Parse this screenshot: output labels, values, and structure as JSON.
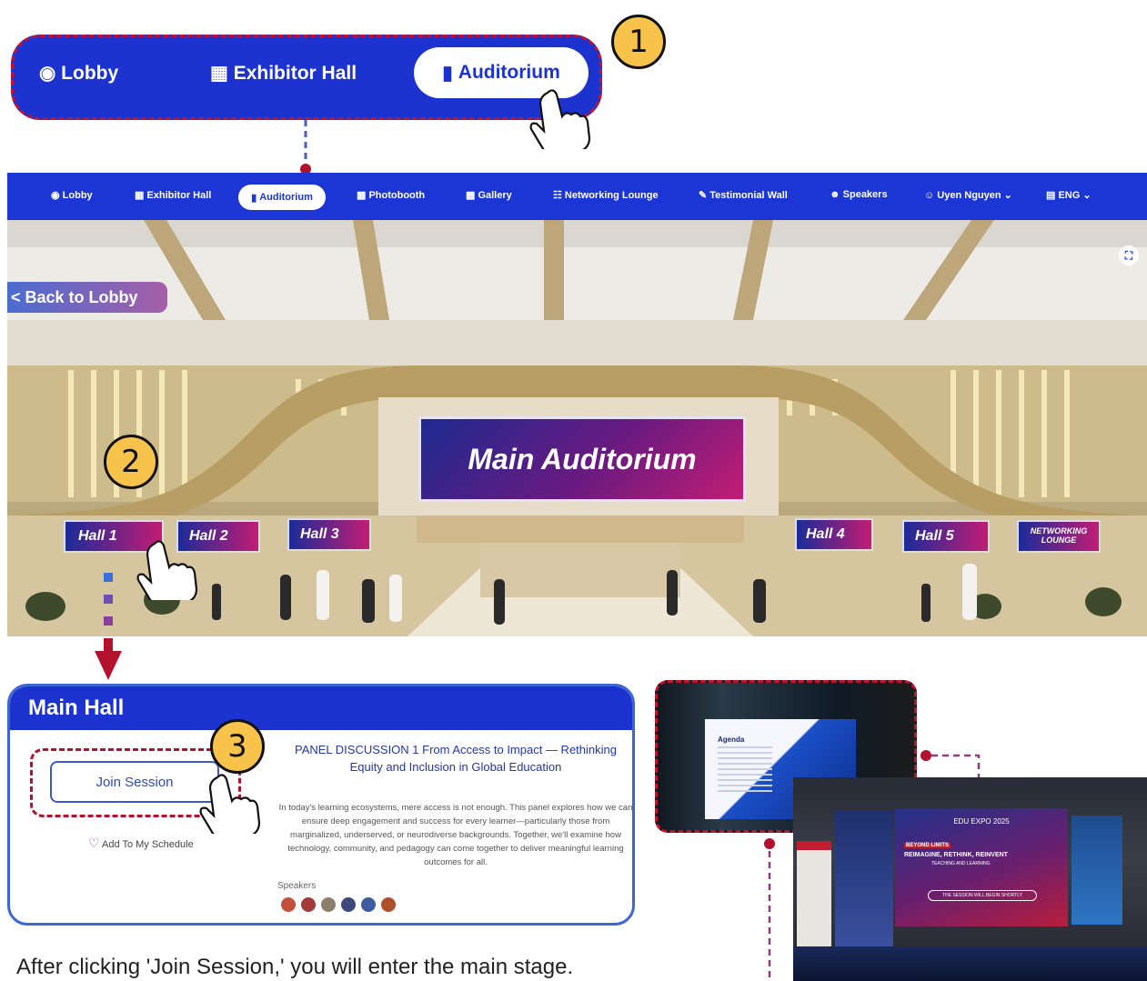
{
  "zoom_nav": {
    "step": "1",
    "lobby": "Lobby",
    "exhibitor_hall": "Exhibitor Hall",
    "auditorium": "Auditorium"
  },
  "navbar": {
    "items": [
      "Lobby",
      "Exhibitor Hall",
      "Auditorium",
      "Photobooth",
      "Gallery",
      "Networking Lounge",
      "Testimonial Wall",
      "Speakers"
    ],
    "user": "Uyen Nguyen",
    "language": "ENG"
  },
  "scene": {
    "back_link": "< Back to Lobby",
    "sign": "Main Auditorium",
    "step": "2",
    "halls": [
      "Hall 1",
      "Hall 2",
      "Hall 3",
      "Hall 4",
      "Hall 5"
    ],
    "networking_l1": "NETWORKING",
    "networking_l2": "LOUNGE"
  },
  "hall_panel": {
    "title": "Main Hall",
    "step": "3",
    "join_button": "Join Session",
    "add_schedule": "Add To My Schedule",
    "session_title": "PANEL DISCUSSION 1 From Access to Impact — Rethinking Equity and Inclusion in Global Education",
    "description": "In today's learning ecosystems, mere access is not enough. This panel explores how we can ensure deep engagement and success for every learner—particularly those from marginalized, underserved, or neurodiverse backgrounds. Together, we'll examine how technology, community, and pedagogy can come together to deliver meaningful learning outcomes for all.",
    "speakers_label": "Speakers"
  },
  "stage": {
    "slide_title": "Agenda",
    "banner_l1": "BEYOND LIMITS",
    "banner_l2": "REIMAGINE, RETHINK, REINVENT",
    "banner_l3": "TEACHING AND LEARNING",
    "banner_notice": "THE SESSION WILL BEGIN SHORTLY",
    "banner_brand": "EDU EXPO 2025"
  },
  "caption": "After clicking 'Join Session,' you will enter the main stage.",
  "colors": {
    "brand_blue": "#1c36d6",
    "accent_red": "#c4122e",
    "step_yellow": "#f7c34a"
  }
}
